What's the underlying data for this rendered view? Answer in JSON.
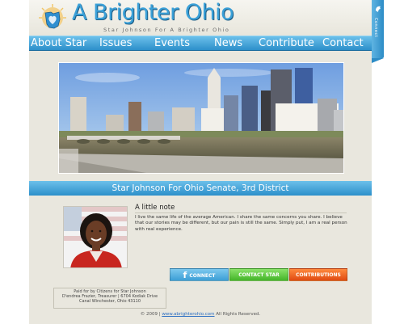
{
  "header": {
    "title": "A Brighter Ohio",
    "tagline": "Star Johnson For A Brighter Ohio"
  },
  "nav": {
    "items": [
      {
        "label": "About Star"
      },
      {
        "label": "Issues"
      },
      {
        "label": "Events"
      },
      {
        "label": "News"
      },
      {
        "label": "Contribute"
      },
      {
        "label": "Contact"
      }
    ]
  },
  "side_tab": {
    "label": "Connect"
  },
  "banner": {
    "text": "Star Johnson For Ohio Senate, 3rd District"
  },
  "note": {
    "heading": "A little note",
    "body": "I live the same life of the average American. I share the same concerns you share. I believe that our stories may be different, but our pain is still the same. Simply put, I am a real person with real experience."
  },
  "buttons": {
    "connect": "CONNECT",
    "connect_icon": "f",
    "contact": "CONTACT STAR",
    "contributions": "CONTRIBUTIONS"
  },
  "paid_for": {
    "line1": "Paid for by Citizens for Star Johnson",
    "line2": "D'endrea Frazier, Treasurer | 6704 Kodiak Drive",
    "line3": "Canal Winchester, Ohio 43110"
  },
  "footer": {
    "prefix": "© 2009 |",
    "link": "www.abrighterohio.com",
    "suffix": "All Rights Reserved."
  },
  "colors": {
    "accent_blue": "#2c8fca",
    "title_blue": "#3aa0d8",
    "page_bg": "#e9e7de",
    "connect_btn": "#3d9fd6",
    "contact_btn": "#45b52a",
    "contrib_btn": "#e04b12"
  },
  "icons": {
    "logo": "ohio-sun-logo-icon",
    "side_tab": "bird-icon",
    "connect": "facebook-icon"
  }
}
